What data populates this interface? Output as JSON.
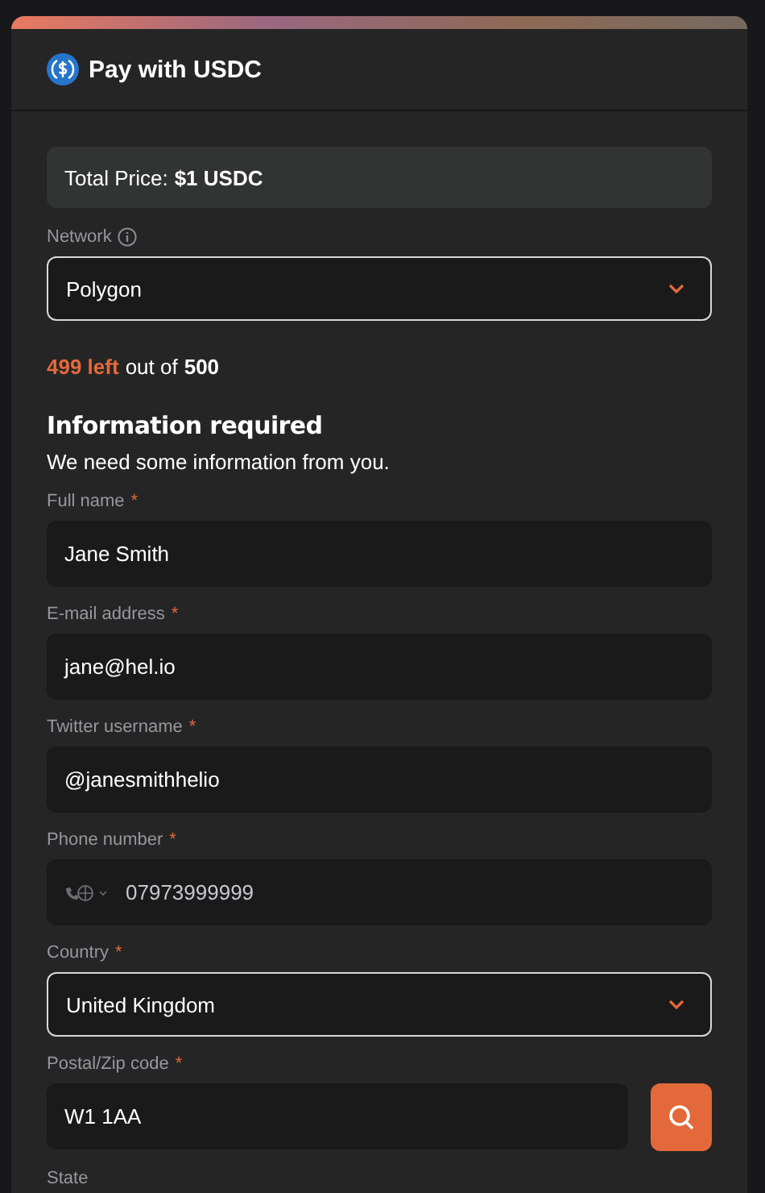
{
  "header": {
    "title": "Pay with USDC"
  },
  "total_price": "Total Price: **$1 USDC**",
  "network": {
    "label": "Network",
    "value": "Polygon"
  },
  "stock": {
    "remaining": "499 left",
    "middle": "out of",
    "total": "500"
  },
  "info": {
    "heading": "Information required",
    "subtitle": "We need some information from you."
  },
  "fields": [
    {
      "kind": "text",
      "label": "Full name",
      "required_mark": "*",
      "value": "Jane Smith"
    },
    {
      "kind": "text",
      "label": "E-mail address",
      "required_mark": "*",
      "value": "jane@hel.io"
    },
    {
      "kind": "text",
      "label": "Twitter username",
      "required_mark": "*",
      "value": "@janesmithhelio"
    },
    {
      "kind": "phone",
      "label": "Phone number",
      "required_mark": "*",
      "value": "07973999999"
    },
    {
      "kind": "select",
      "label": "Country",
      "required_mark": "*",
      "value": "United Kingdom"
    },
    {
      "kind": "postal",
      "label": "Postal/Zip code",
      "required_mark": "*",
      "value": "W1 1AA"
    },
    {
      "kind": "label",
      "label": "State"
    }
  ]
}
